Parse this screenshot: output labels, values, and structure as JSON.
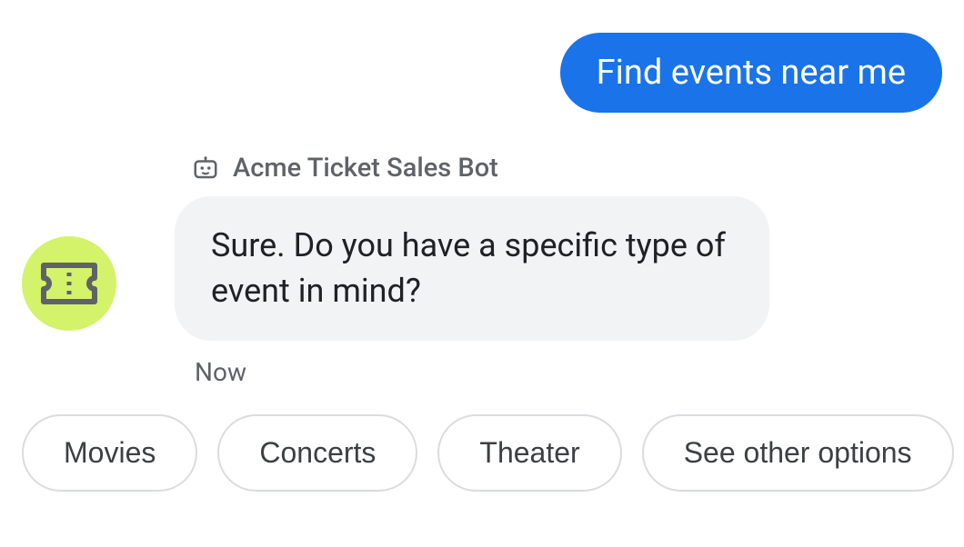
{
  "user_message": "Find events near me",
  "bot": {
    "name": "Acme Ticket Sales Bot",
    "message": "Sure. Do you have a specific type of event in mind?",
    "timestamp": "Now"
  },
  "chips": [
    "Movies",
    "Concerts",
    "Theater",
    "See other options"
  ],
  "colors": {
    "user_bubble": "#1a73e8",
    "bot_bubble": "#f1f3f4",
    "avatar_bg": "#d4f26a"
  }
}
